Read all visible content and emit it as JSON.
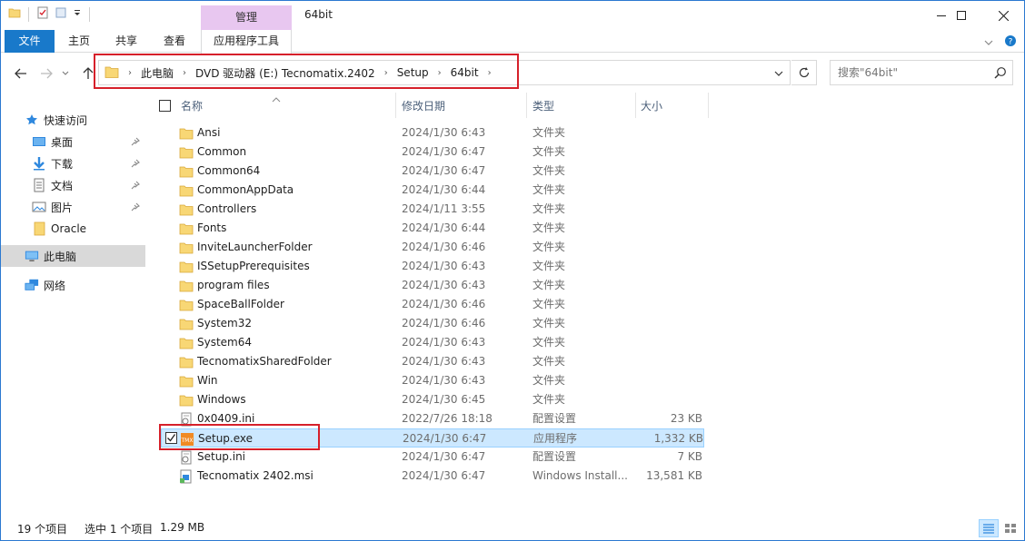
{
  "titlebar": {
    "manage_tab": "管理",
    "window_title": "64bit"
  },
  "ribbon": {
    "tabs": [
      "文件",
      "主页",
      "共享",
      "查看",
      "应用程序工具"
    ]
  },
  "address": {
    "crumbs": [
      "此电脑",
      "DVD 驱动器 (E:) Tecnomatix.2402",
      "Setup",
      "64bit"
    ],
    "search_placeholder": "搜索\"64bit\""
  },
  "nav": {
    "quick_access": "快速访问",
    "items": [
      "桌面",
      "下载",
      "文档",
      "图片",
      "Oracle"
    ],
    "this_pc": "此电脑",
    "network": "网络"
  },
  "columns": {
    "name": "名称",
    "date": "修改日期",
    "type": "类型",
    "size": "大小"
  },
  "files": [
    {
      "name": "Ansi",
      "date": "2024/1/30 6:43",
      "type": "文件夹",
      "size": "",
      "icon": "folder"
    },
    {
      "name": "Common",
      "date": "2024/1/30 6:47",
      "type": "文件夹",
      "size": "",
      "icon": "folder"
    },
    {
      "name": "Common64",
      "date": "2024/1/30 6:47",
      "type": "文件夹",
      "size": "",
      "icon": "folder"
    },
    {
      "name": "CommonAppData",
      "date": "2024/1/30 6:44",
      "type": "文件夹",
      "size": "",
      "icon": "folder"
    },
    {
      "name": "Controllers",
      "date": "2024/1/11 3:55",
      "type": "文件夹",
      "size": "",
      "icon": "folder"
    },
    {
      "name": "Fonts",
      "date": "2024/1/30 6:44",
      "type": "文件夹",
      "size": "",
      "icon": "folder"
    },
    {
      "name": "InviteLauncherFolder",
      "date": "2024/1/30 6:46",
      "type": "文件夹",
      "size": "",
      "icon": "folder"
    },
    {
      "name": "ISSetupPrerequisites",
      "date": "2024/1/30 6:43",
      "type": "文件夹",
      "size": "",
      "icon": "folder"
    },
    {
      "name": "program files",
      "date": "2024/1/30 6:43",
      "type": "文件夹",
      "size": "",
      "icon": "folder"
    },
    {
      "name": "SpaceBallFolder",
      "date": "2024/1/30 6:46",
      "type": "文件夹",
      "size": "",
      "icon": "folder"
    },
    {
      "name": "System32",
      "date": "2024/1/30 6:46",
      "type": "文件夹",
      "size": "",
      "icon": "folder"
    },
    {
      "name": "System64",
      "date": "2024/1/30 6:43",
      "type": "文件夹",
      "size": "",
      "icon": "folder"
    },
    {
      "name": "TecnomatixSharedFolder",
      "date": "2024/1/30 6:43",
      "type": "文件夹",
      "size": "",
      "icon": "folder"
    },
    {
      "name": "Win",
      "date": "2024/1/30 6:43",
      "type": "文件夹",
      "size": "",
      "icon": "folder"
    },
    {
      "name": "Windows",
      "date": "2024/1/30 6:45",
      "type": "文件夹",
      "size": "",
      "icon": "folder"
    },
    {
      "name": "0x0409.ini",
      "date": "2022/7/26 18:18",
      "type": "配置设置",
      "size": "23 KB",
      "icon": "ini"
    },
    {
      "name": "Setup.exe",
      "date": "2024/1/30 6:47",
      "type": "应用程序",
      "size": "1,332 KB",
      "icon": "exe",
      "selected": true
    },
    {
      "name": "Setup.ini",
      "date": "2024/1/30 6:47",
      "type": "配置设置",
      "size": "7 KB",
      "icon": "ini"
    },
    {
      "name": "Tecnomatix 2402.msi",
      "date": "2024/1/30 6:47",
      "type": "Windows Install...",
      "size": "13,581 KB",
      "icon": "msi"
    }
  ],
  "status": {
    "count": "19 个项目",
    "selected": "选中 1 个项目",
    "size": "1.29 MB"
  },
  "colors": {
    "accent": "#1979ca",
    "selection": "#cce8ff",
    "highlight_box": "#d6202a",
    "folder": "#f8d775"
  }
}
